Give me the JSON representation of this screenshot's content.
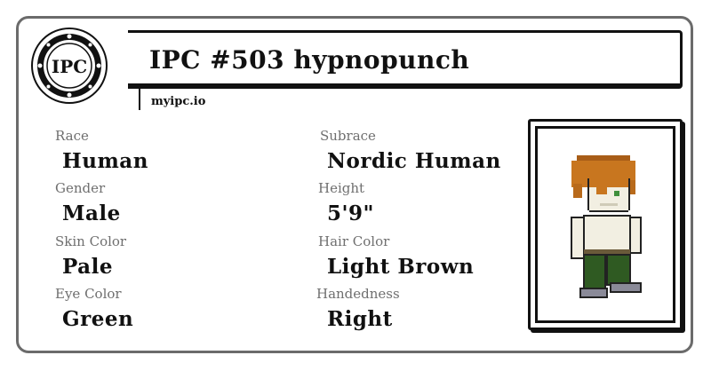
{
  "card": {
    "logo_text": "IPC",
    "title": "IPC #503 hypnopunch",
    "site": "myipc.io",
    "fields": [
      {
        "label": "Race",
        "value": "Human"
      },
      {
        "label": "Subrace",
        "value": "Nordic Human"
      },
      {
        "label": "Gender",
        "value": "Male"
      },
      {
        "label": "Height",
        "value": "5'9\""
      },
      {
        "label": "Skin Color",
        "value": "Pale"
      },
      {
        "label": "Hair Color",
        "value": "Light Brown"
      },
      {
        "label": "Eye Color",
        "value": "Green"
      },
      {
        "label": "Handedness",
        "value": "Right"
      }
    ]
  },
  "colors": {
    "border": "#6b6b6b",
    "label": "#6f6f6f",
    "hair": "#c8761f",
    "skin": "#f2efe2",
    "pants": "#2f5a22"
  }
}
